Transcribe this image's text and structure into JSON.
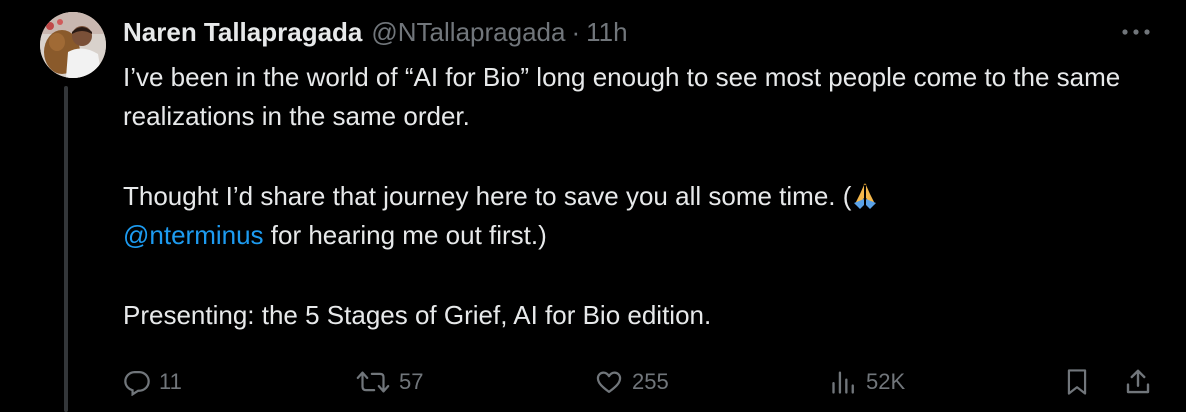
{
  "tweet": {
    "author_name": "Naren Tallapragada",
    "handle": "@NTallapragada",
    "separator": "·",
    "time": "11h",
    "body": {
      "line1": "I’ve been in the world of “AI for Bio” long enough to see most people come to the same realizations in the same order.",
      "line2_prefix": "Thought I’d share that journey here to save you all some time. (",
      "emoji": "pray-emoji",
      "mention": "@nterminus",
      "line2_suffix": " for hearing me out first.)",
      "line3": "Presenting: the 5 Stages of Grief, AI for Bio edition."
    },
    "stats": {
      "replies": "11",
      "reposts": "57",
      "likes": "255",
      "views": "52K"
    }
  },
  "colors": {
    "background": "#000000",
    "text": "#e7e9ea",
    "secondary": "#71767b",
    "link": "#1d9bf0",
    "thread_line": "#333639"
  },
  "icons": [
    "more-icon",
    "reply-icon",
    "repost-icon",
    "like-icon",
    "views-icon",
    "bookmark-icon",
    "share-icon"
  ]
}
